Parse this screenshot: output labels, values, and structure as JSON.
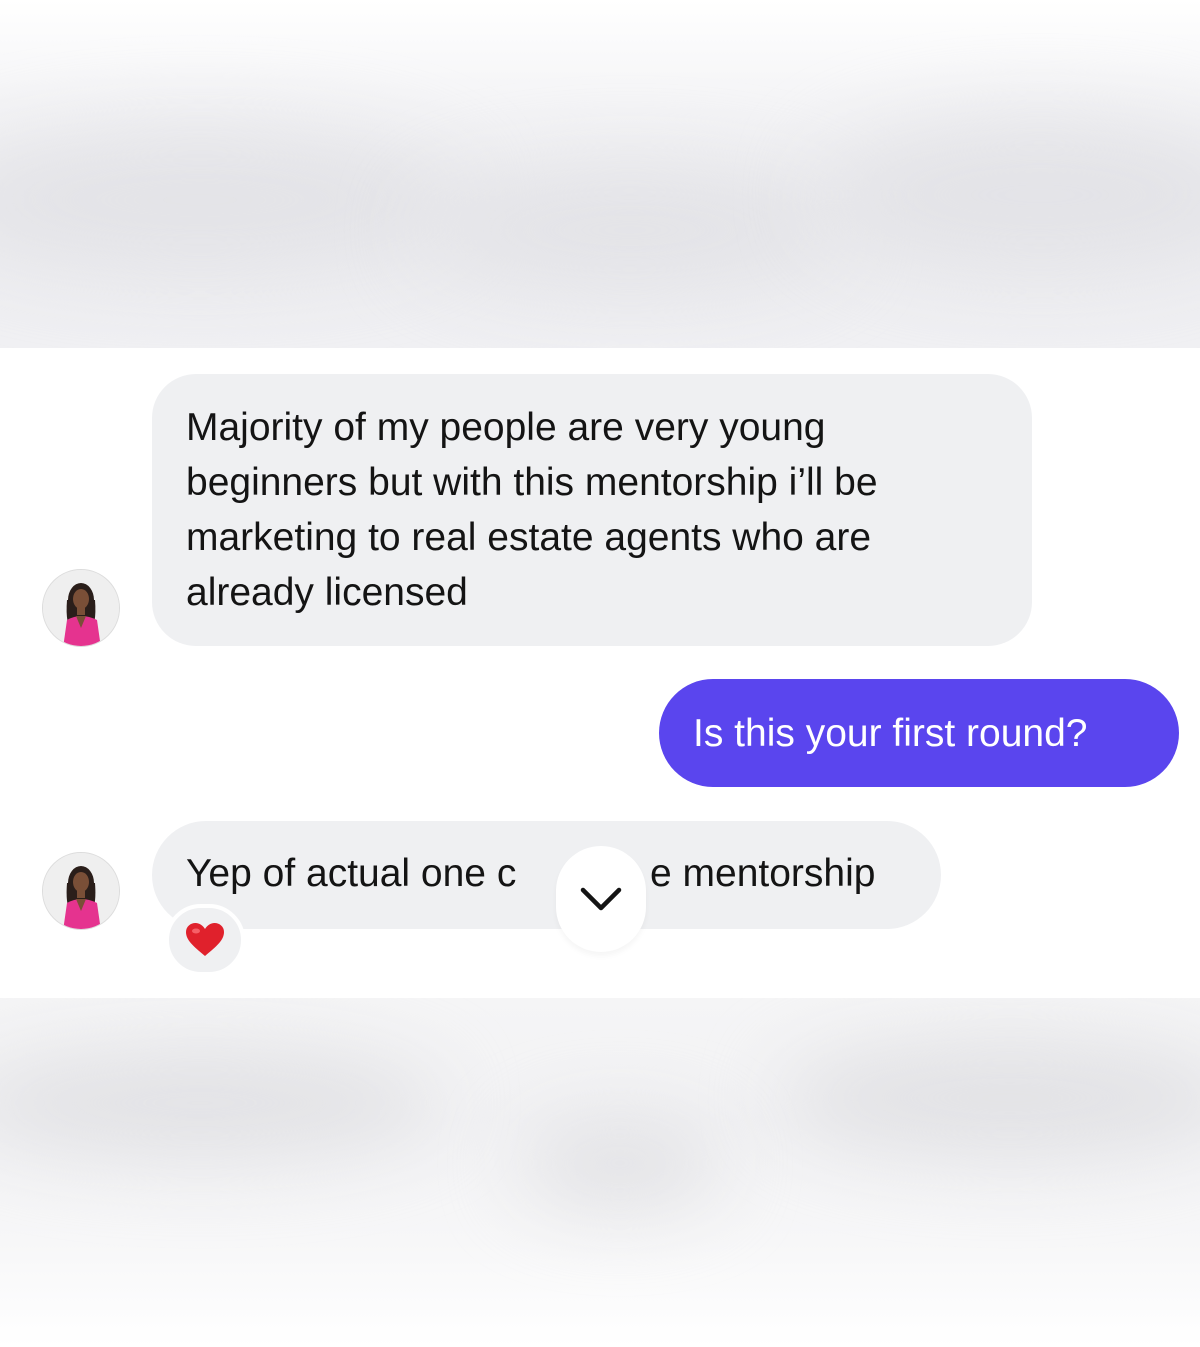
{
  "conversation": {
    "messages": [
      {
        "direction": "incoming",
        "text": "Majority of my people are very young beginners but with this mentorship i’ll be marketing to real estate agents who are already licensed"
      },
      {
        "direction": "outgoing",
        "text": "Is this your first round?"
      },
      {
        "direction": "incoming",
        "text": "Yep of actual one c",
        "text_after_overlay": "e mentorship",
        "reaction": "❤️"
      }
    ]
  },
  "icons": {
    "avatar": "profile-photo-icon",
    "reaction": "heart-icon",
    "scroll": "chevron-down-icon"
  },
  "colors": {
    "incoming_bubble": "#eff0f2",
    "outgoing_bubble": "#5a45ee",
    "heart": "#e0212c"
  }
}
